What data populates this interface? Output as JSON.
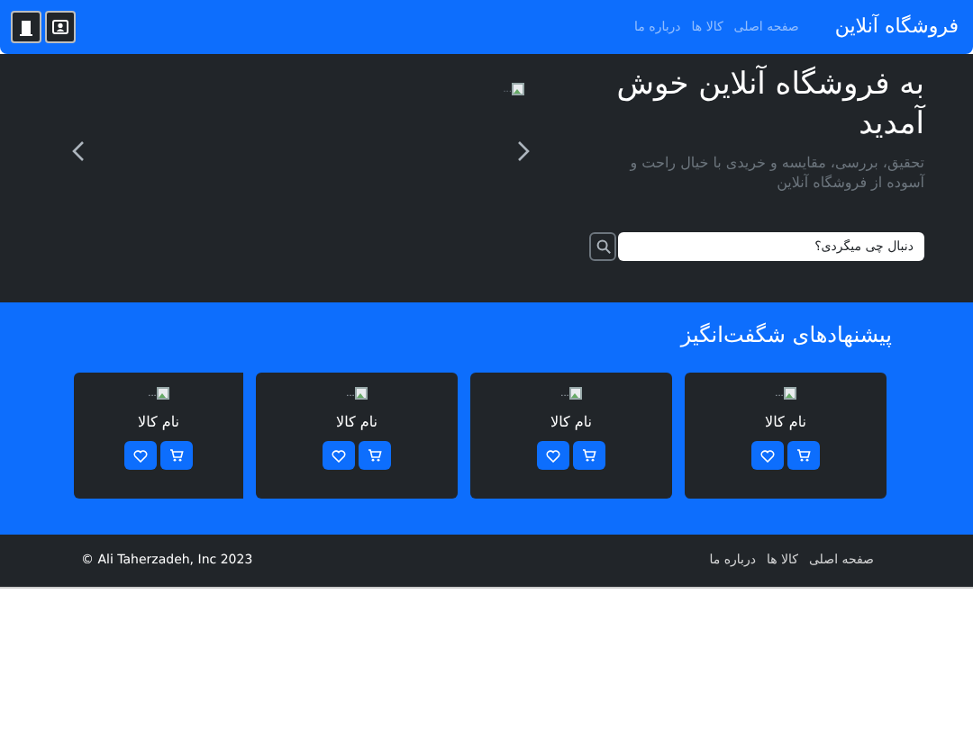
{
  "navbar": {
    "brand": "فروشگاه آنلاین",
    "links": [
      {
        "label": "صفحه اصلی"
      },
      {
        "label": "کالا ها"
      },
      {
        "label": "درباره ما"
      }
    ]
  },
  "hero": {
    "title": "به فروشگاه آنلاین خوش آمدید",
    "subtitle": "تحقیق، بررسی، مقایسه و خریدی با خیال راحت و آسوده از فروشگاه آنلاین",
    "search_placeholder": "دنبال چی میگردی؟",
    "image_alt": "..."
  },
  "offers": {
    "title": "پیشنهادهای شگفت‌انگیز",
    "products": [
      {
        "image_alt": "...",
        "name": "نام کالا"
      },
      {
        "image_alt": "...",
        "name": "نام کالا"
      },
      {
        "image_alt": "...",
        "name": "نام کالا"
      },
      {
        "image_alt": "...",
        "name": "نام کالا"
      }
    ]
  },
  "footer": {
    "links": [
      {
        "label": "صفحه اصلی"
      },
      {
        "label": "کالا ها"
      },
      {
        "label": "درباره ما"
      }
    ],
    "copyright": "© Ali Taherzadeh, Inc 2023"
  }
}
